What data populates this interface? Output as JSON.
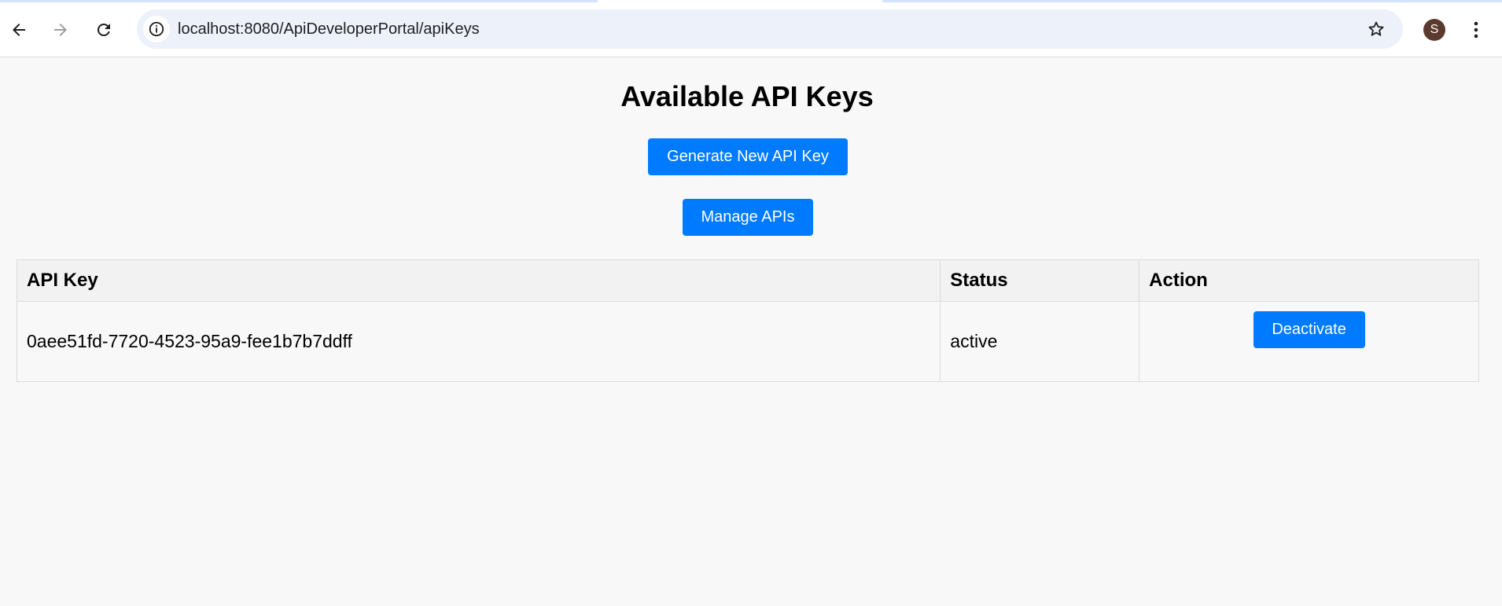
{
  "browser": {
    "url": "localhost:8080/ApiDeveloperPortal/apiKeys",
    "profile_initial": "S"
  },
  "page": {
    "title": "Available API Keys",
    "generate_button": "Generate New API Key",
    "manage_button": "Manage APIs"
  },
  "table": {
    "headers": [
      "API Key",
      "Status",
      "Action"
    ],
    "rows": [
      {
        "api_key": "0aee51fd-7720-4523-95a9-fee1b7b7ddff",
        "status": "active",
        "action_label": "Deactivate"
      }
    ]
  },
  "colors": {
    "primary_button": "#007bff",
    "page_background": "#f8f8f8",
    "omnibox_background": "#edf2fa"
  }
}
